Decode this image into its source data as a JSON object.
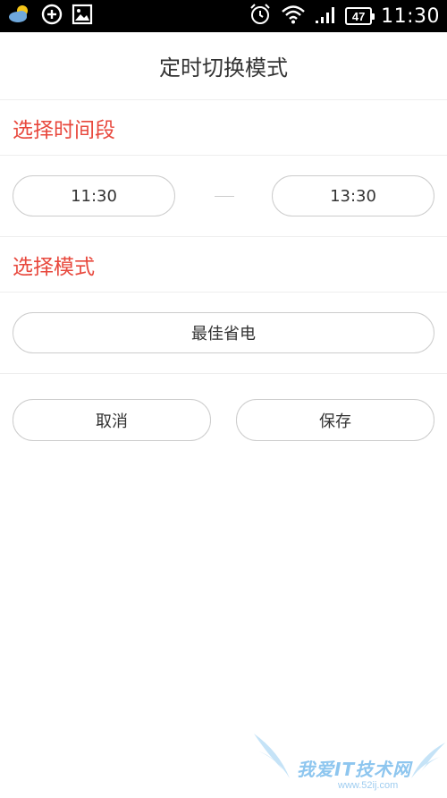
{
  "status_bar": {
    "battery": "47",
    "time": "11:30",
    "icons": [
      "weather-icon",
      "add-circle-icon",
      "image-icon",
      "alarm-icon",
      "wifi-icon",
      "signal-icon"
    ]
  },
  "header": {
    "title": "定时切换模式"
  },
  "time_section": {
    "title": "选择时间段",
    "start_time": "11:30",
    "end_time": "13:30"
  },
  "mode_section": {
    "title": "选择模式",
    "selected_mode": "最佳省电"
  },
  "actions": {
    "cancel_label": "取消",
    "save_label": "保存"
  },
  "watermark": {
    "text": "我爱IT技术网",
    "url": "www.52ij.com"
  },
  "colors": {
    "accent": "#e8483d",
    "border": "#cccccc",
    "divider": "#eeeeee"
  }
}
